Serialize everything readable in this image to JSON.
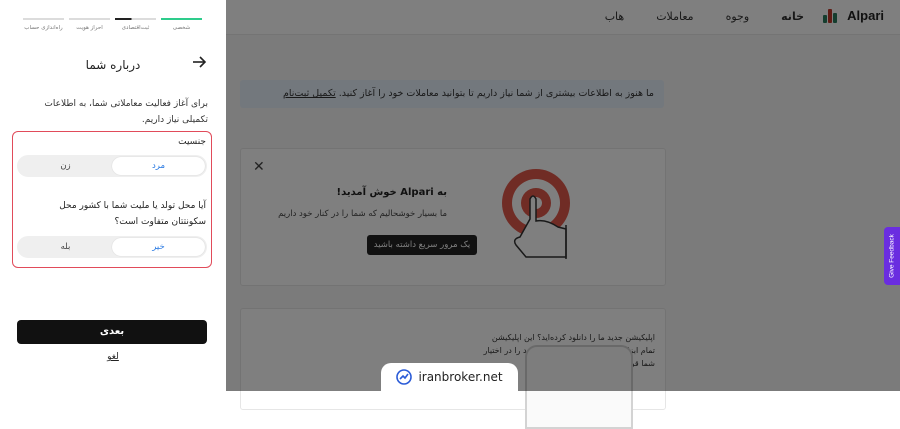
{
  "background": {
    "logo_text": "Alpari",
    "nav": [
      "خانه",
      "وجوه",
      "معاملات",
      "هاب"
    ],
    "banner_text": "ما هنوز به اطلاعات بیشتری از شما نیاز داریم تا بتوانید معاملات خود را آغاز کنید.",
    "banner_link": "تکمیل ثبت‌نام",
    "welcome_title": "به Alpari خوش آمدید!",
    "welcome_sub": "ما بسیار خوشحالیم که شما را در کنار خود داریم",
    "tour_button": "یک مرور سریع داشته باشید",
    "app_text": "اپلیکیشن جدید ما را دانلود کرده‌اید؟ این اپلیکیشن تمام ابزارهایی که برای معامله نیاز دارید را در اختیار شما قرار خواهد داد!"
  },
  "feedback_tab": "Give Feedback",
  "watermark": "iranbroker.net",
  "panel": {
    "steps": [
      {
        "label": "شخصی",
        "state": "done"
      },
      {
        "label": "ثبت‌اقتصادی",
        "state": "current"
      },
      {
        "label": "احراز هویت",
        "state": "todo"
      },
      {
        "label": "راه‌اندازی حساب",
        "state": "todo"
      }
    ],
    "title": "درباره شما",
    "intro": "برای آغاز فعالیت معاملاتی شما، به اطلاعات تکمیلی نیاز داریم.",
    "gender": {
      "label": "جنسیت",
      "options": [
        "مرد",
        "زن"
      ],
      "selected": "مرد"
    },
    "residency": {
      "label": "آیا محل تولد یا ملیت شما با کشور محل سکونتتان متفاوت است؟",
      "options": [
        "خیر",
        "بله"
      ],
      "selected": "خیر"
    },
    "next_button": "بعدی",
    "cancel_link": "لغو"
  },
  "colors": {
    "accent_selected": "#2a7ae2",
    "highlight_border": "#e14b5a",
    "step_done": "#2ecc8c",
    "feedback": "#6a2de0"
  }
}
